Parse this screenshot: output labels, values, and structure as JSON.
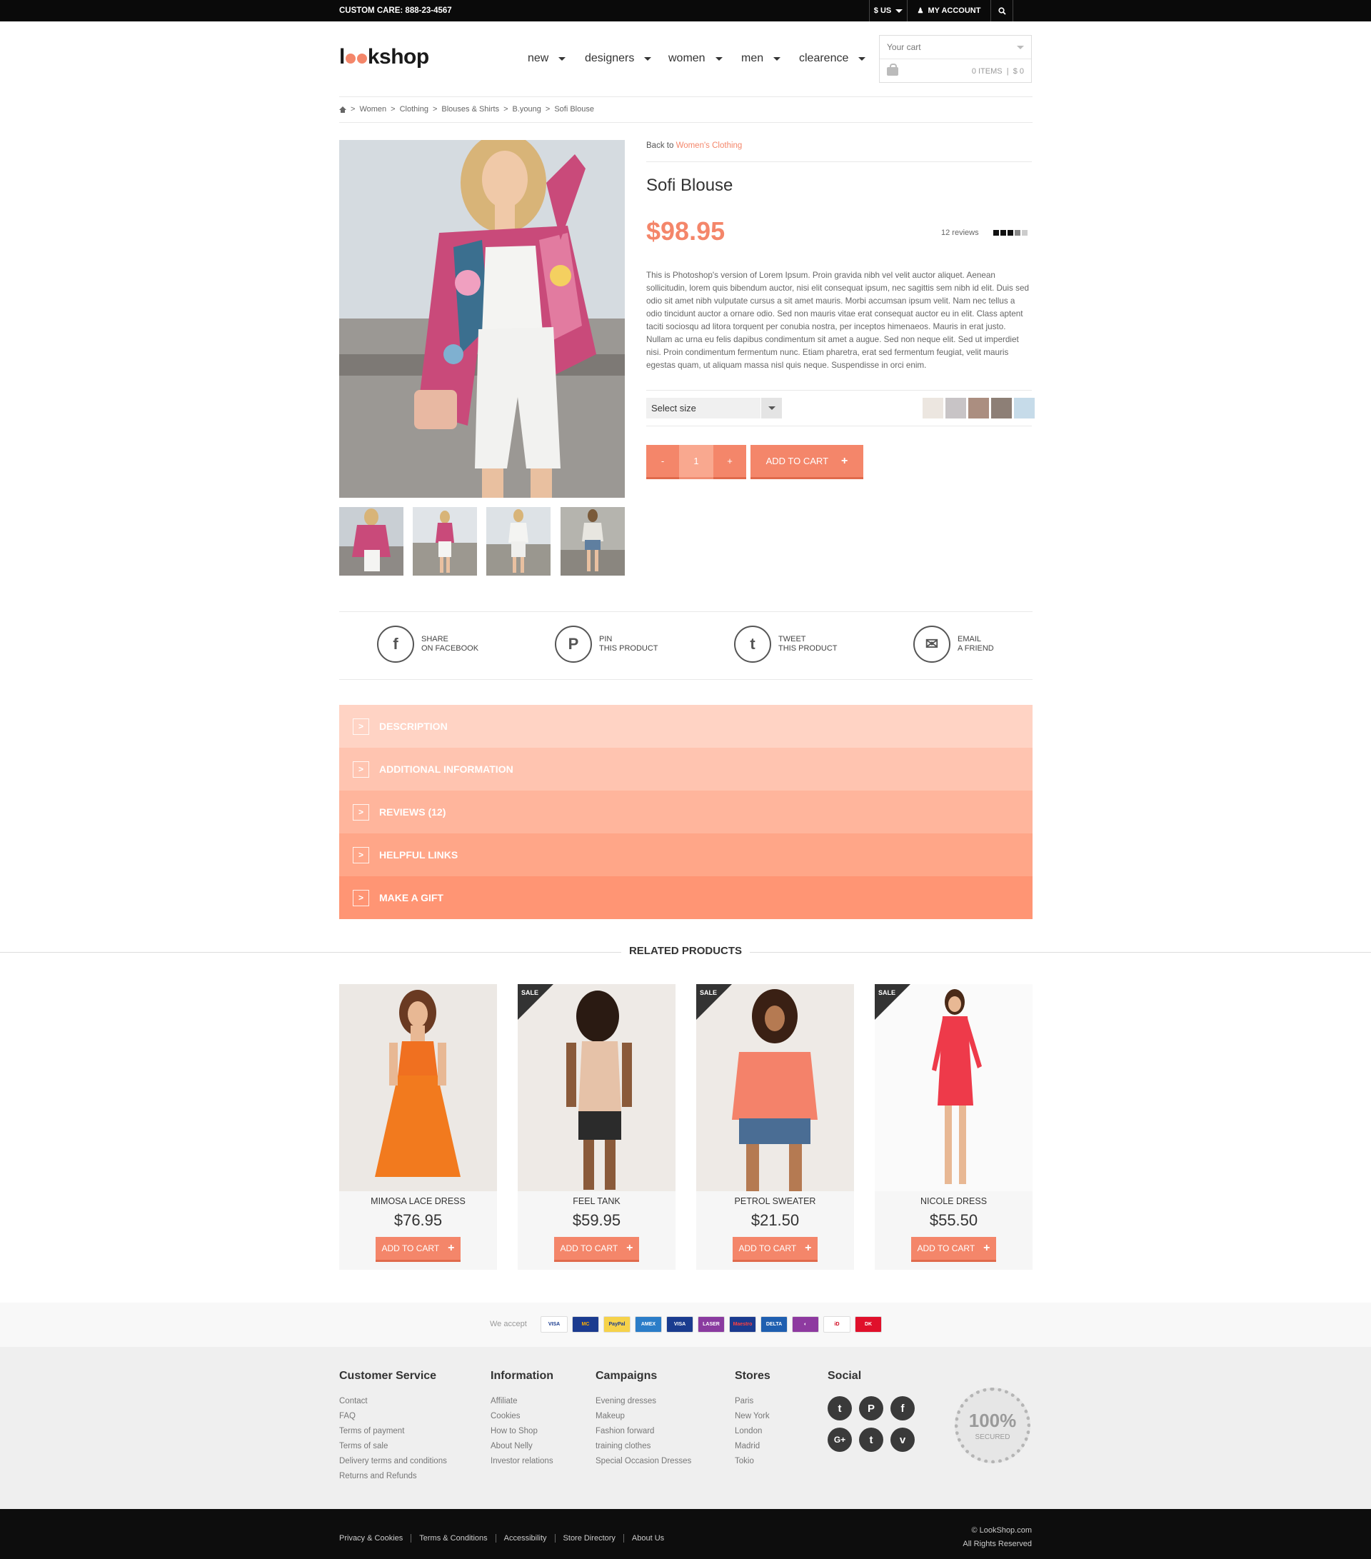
{
  "topbar": {
    "custom_care": "CUSTOM CARE: 888-23-4567",
    "currency": "$ US",
    "account": "MY ACCOUNT"
  },
  "header": {
    "logo_pre": "l",
    "logo_post": "kshop",
    "nav": [
      "new",
      "designers",
      "women",
      "men",
      "clearence"
    ],
    "cart_label": "Your cart",
    "cart_items": "0  ITEMS",
    "cart_total": "$ 0"
  },
  "breadcrumb": [
    "Women",
    "Clothing",
    "Blouses & Shirts",
    "B.young",
    "Sofi Blouse"
  ],
  "product": {
    "back_prefix": "Back to",
    "back_link": "Women's Clothing",
    "title": "Sofi Blouse",
    "price": "$98.95",
    "reviews": "12 reviews",
    "rating": 3.5,
    "description": "This is Photoshop's version of Lorem Ipsum. Proin gravida nibh vel velit auctor aliquet. Aenean sollicitudin, lorem quis bibendum auctor, nisi elit consequat ipsum, nec sagittis sem nibh id elit. Duis sed odio sit amet nibh vulputate cursus a sit amet mauris. Morbi accumsan ipsum velit. Nam nec tellus a odio tincidunt auctor a ornare odio. Sed non mauris vitae erat consequat auctor eu in elit. Class aptent taciti sociosqu ad litora torquent per conubia nostra, per inceptos himenaeos. Mauris in erat justo. Nullam ac urna eu felis dapibus condimentum sit amet a augue. Sed non neque elit. Sed ut imperdiet nisi. Proin condimentum fermentum nunc. Etiam pharetra, erat sed fermentum feugiat, velit mauris egestas quam, ut aliquam massa nisl quis neque. Suspendisse in orci enim.",
    "size_placeholder": "Select size",
    "swatches": [
      "#ece6e0",
      "#c8c4c6",
      "#ab8e80",
      "#8d7f76",
      "#c6dbe9"
    ],
    "qty_minus": "-",
    "qty_value": "1",
    "qty_plus": "+",
    "add_to_cart": "ADD TO CART"
  },
  "share": [
    {
      "icon": "facebook-icon",
      "glyph": "f",
      "line1": "SHARE",
      "line2": "ON FACEBOOK"
    },
    {
      "icon": "pinterest-icon",
      "glyph": "P",
      "line1": "PIN",
      "line2": "THIS PRODUCT"
    },
    {
      "icon": "twitter-icon",
      "glyph": "t",
      "line1": "TWEET",
      "line2": "THIS PRODUCT"
    },
    {
      "icon": "email-icon",
      "glyph": "✉",
      "line1": "EMAIL",
      "line2": "A FRIEND"
    }
  ],
  "accordion": [
    {
      "label": "DESCRIPTION",
      "color": "#ffd3c4"
    },
    {
      "label": "ADDITIONAL INFORMATION",
      "color": "#ffc4b0"
    },
    {
      "label": "REVIEWS (12)",
      "color": "#ffb59c"
    },
    {
      "label": "HELPFUL LINKS",
      "color": "#ffa688"
    },
    {
      "label": "MAKE A GIFT",
      "color": "#ff9574"
    }
  ],
  "related": {
    "title": "RELATED PRODUCTS",
    "sale_label": "SALE",
    "button": "ADD TO CART",
    "items": [
      {
        "name": "MIMOSA LACE DRESS",
        "price": "$76.95",
        "sale": false
      },
      {
        "name": "FEEL TANK",
        "price": "$59.95",
        "sale": true
      },
      {
        "name": "PETROL SWEATER",
        "price": "$21.50",
        "sale": true
      },
      {
        "name": "NICOLE DRESS",
        "price": "$55.50",
        "sale": true
      }
    ]
  },
  "payments": {
    "label": "We accept",
    "cards": [
      {
        "text": "VISA",
        "color": "#ffffff",
        "fg": "#1a3c8f"
      },
      {
        "text": "MC",
        "color": "#1b3b8f",
        "fg": "#ffb000"
      },
      {
        "text": "PayPal",
        "color": "#f6d24a",
        "fg": "#1b3b8f"
      },
      {
        "text": "AMEX",
        "color": "#2b7dc8",
        "fg": "#ffffff"
      },
      {
        "text": "VISA",
        "color": "#1a3c8f",
        "fg": "#ffffff"
      },
      {
        "text": "LASER",
        "color": "#8a3ba0",
        "fg": "#ffffff"
      },
      {
        "text": "Maestro",
        "color": "#1b3b8f",
        "fg": "#ff4040"
      },
      {
        "text": "DELTA",
        "color": "#1f5fb0",
        "fg": "#ffffff"
      },
      {
        "text": "◐",
        "color": "#8e3aa0",
        "fg": "#ffffff"
      },
      {
        "text": "iD",
        "color": "#ffffff",
        "fg": "#d0021b"
      },
      {
        "text": "DK",
        "color": "#e0102b",
        "fg": "#ffffff"
      }
    ]
  },
  "footer": {
    "columns": [
      {
        "title": "Customer Service",
        "links": [
          "Contact",
          "FAQ",
          "Terms of payment",
          "Terms of sale",
          "Delivery terms and conditions",
          "Returns and Refunds"
        ]
      },
      {
        "title": "Information",
        "links": [
          "Affiliate",
          "Cookies",
          "How to Shop",
          "About Nelly",
          "Investor relations"
        ]
      },
      {
        "title": "Campaigns",
        "links": [
          "Evening dresses",
          "Makeup",
          "Fashion forward",
          "training clothes",
          "Special Occasion Dresses"
        ]
      },
      {
        "title": "Stores",
        "links": [
          "Paris",
          "New York",
          "London",
          "Madrid",
          "Tokio"
        ]
      }
    ],
    "social_title": "Social",
    "social": [
      {
        "icon": "twitter-icon",
        "glyph": "t"
      },
      {
        "icon": "pinterest-icon",
        "glyph": "P"
      },
      {
        "icon": "facebook-icon",
        "glyph": "f"
      },
      {
        "icon": "google-plus-icon",
        "glyph": "G+"
      },
      {
        "icon": "tumblr-icon",
        "glyph": "t"
      },
      {
        "icon": "vimeo-icon",
        "glyph": "v"
      }
    ],
    "badge_big": "100%",
    "badge_small": "SECURED"
  },
  "bottom": {
    "links": [
      "Privacy & Cookies",
      "Terms & Conditions",
      "Accessibility",
      "Store Directory",
      "About Us"
    ],
    "copyright": "© LookShop.com",
    "rights": "All Rights Reserved"
  }
}
